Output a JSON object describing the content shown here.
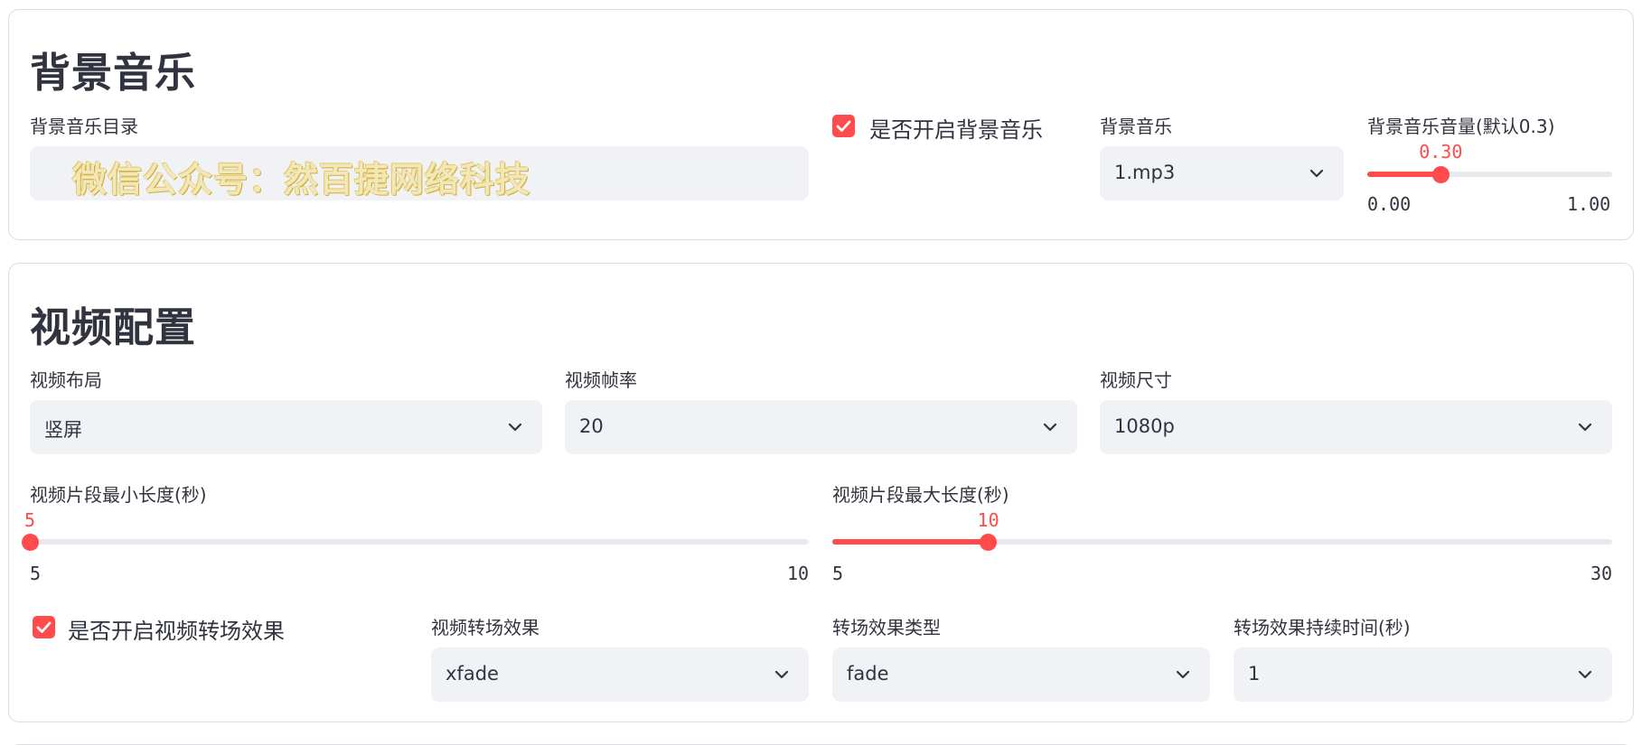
{
  "bgm_section": {
    "title": "背景音乐",
    "dir_label": "背景音乐目录",
    "dir_value": "",
    "watermark": "微信公众号：然百捷网络科技",
    "enable_label": "是否开启背景音乐",
    "enable_checked": true,
    "music_label": "背景音乐",
    "music_value": "1.mp3",
    "volume_label": "背景音乐音量(默认0.3)",
    "volume_value": "0.30",
    "volume_min": "0.00",
    "volume_max": "1.00",
    "volume_fraction": 0.3
  },
  "video_section": {
    "title": "视频配置",
    "layout_label": "视频布局",
    "layout_value": "竖屏",
    "fps_label": "视频帧率",
    "fps_value": "20",
    "size_label": "视频尺寸",
    "size_value": "1080p",
    "min_len_label": "视频片段最小长度(秒)",
    "min_len_value": "5",
    "min_len_min": "5",
    "min_len_max": "10",
    "min_len_fraction": 0,
    "max_len_label": "视频片段最大长度(秒)",
    "max_len_value": "10",
    "max_len_min": "5",
    "max_len_max": "30",
    "max_len_fraction": 0.2,
    "transition_enable_label": "是否开启视频转场效果",
    "transition_enable_checked": true,
    "transition_label": "视频转场效果",
    "transition_value": "xfade",
    "transition_type_label": "转场效果类型",
    "transition_type_value": "fade",
    "transition_duration_label": "转场效果持续时间(秒)",
    "transition_duration_value": "1"
  },
  "icons": {
    "chevron": "chevron-down-icon",
    "check": "check-icon"
  },
  "colors": {
    "accent": "#ff4b4b",
    "input_bg": "#f0f2f6",
    "text": "#31333f",
    "border": "#dcdde1"
  }
}
